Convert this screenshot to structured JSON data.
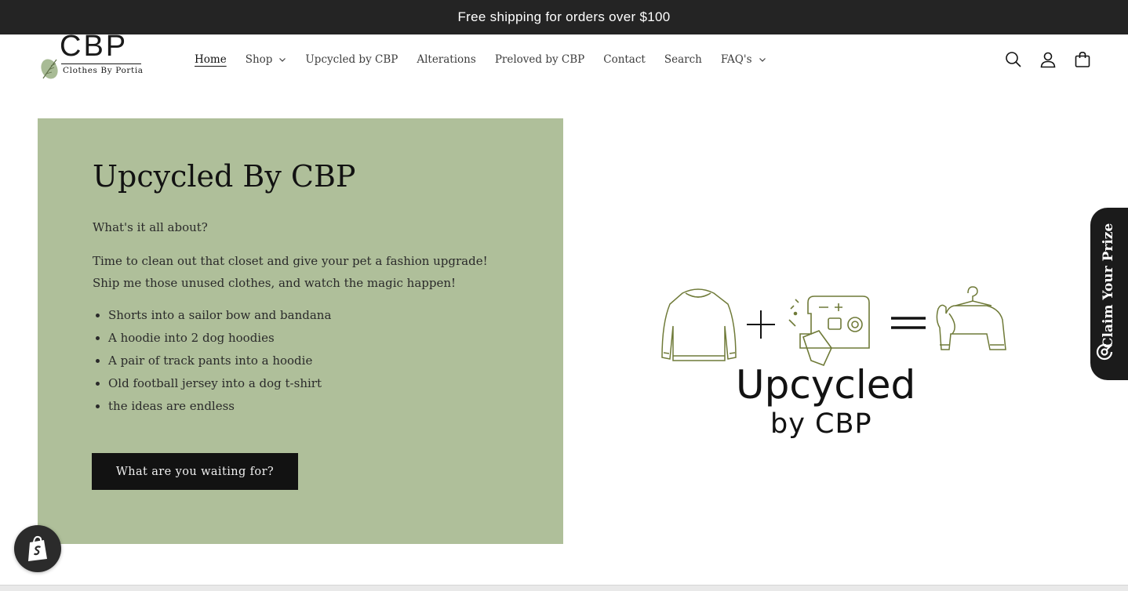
{
  "announcement": {
    "text": "Free shipping for orders over $100"
  },
  "logo": {
    "mark": "CBP",
    "subtitle": "Clothes By Portia"
  },
  "nav": {
    "items": [
      {
        "label": "Home",
        "active": true,
        "dropdown": false
      },
      {
        "label": "Shop",
        "active": false,
        "dropdown": true
      },
      {
        "label": "Upcycled by CBP",
        "active": false,
        "dropdown": false
      },
      {
        "label": "Alterations",
        "active": false,
        "dropdown": false
      },
      {
        "label": "Preloved by CBP",
        "active": false,
        "dropdown": false
      },
      {
        "label": "Contact",
        "active": false,
        "dropdown": false
      },
      {
        "label": "Search",
        "active": false,
        "dropdown": false
      },
      {
        "label": "FAQ's",
        "active": false,
        "dropdown": true
      }
    ]
  },
  "header_icons": [
    "search-icon",
    "account-icon",
    "cart-icon"
  ],
  "hero": {
    "title": "Upcycled By CBP",
    "subtitle": "What's it all about?",
    "paragraph_lines": [
      "Time to clean out that closet and give your pet a fashion upgrade!",
      "Ship me those unused clothes, and watch the magic happen!"
    ],
    "list": [
      "Shorts into a sailor bow and bandana",
      "A hoodie into 2 dog hoodies",
      "A pair of track pants into a hoodie",
      "Old football jersey into a dog t-shirt",
      "the ideas are endless"
    ],
    "cta": "What are you waiting for?"
  },
  "illustration": {
    "word1": "Upcycled",
    "word2": "by CBP",
    "icons": [
      "sweater-icon",
      "plus-icon",
      "sewing-machine-icon",
      "equals-icon",
      "dog-hoodie-icon"
    ]
  },
  "prize_tab": {
    "label": "Claim Your Prize",
    "icon": "prize-icon"
  },
  "shop_badge": {
    "icon": "shopify-bag-icon"
  },
  "colors": {
    "announcement_bg": "#242424",
    "panel_bg": "#afbf9a",
    "button_bg": "#121212",
    "illustration_olive": "#6f7a38",
    "prize_tab_bg": "#1b1b1b"
  }
}
